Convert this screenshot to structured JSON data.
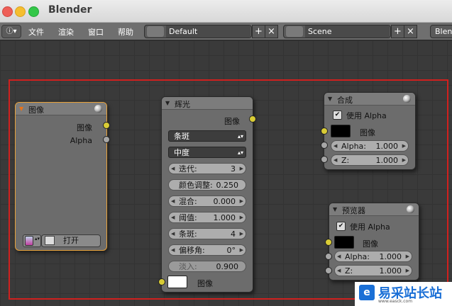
{
  "window": {
    "title": "Blender"
  },
  "menubar": {
    "items": [
      "文件",
      "渲染",
      "窗口",
      "帮助"
    ],
    "layout_value": "Default",
    "scene_value": "Scene",
    "engine_value": "Blen"
  },
  "nodes": {
    "image": {
      "title": "图像",
      "out_image": "图像",
      "out_alpha": "Alpha",
      "open_label": "打开"
    },
    "glare": {
      "title": "辉光",
      "out_image": "图像",
      "glare_type": "条斑",
      "quality": "中度",
      "iterations": {
        "label": "迭代:",
        "value": "3"
      },
      "color_mod": {
        "label": "颜色调整:",
        "value": "0.250"
      },
      "mix": {
        "label": "混合:",
        "value": "0.000"
      },
      "threshold": {
        "label": "阈值:",
        "value": "1.000"
      },
      "streaks": {
        "label": "条斑:",
        "value": "4"
      },
      "angle": {
        "label": "偏移角:",
        "value": "0°"
      },
      "fade": {
        "label": "淡入:",
        "value": "0.900"
      },
      "in_image": "图像"
    },
    "composite": {
      "title": "合成",
      "use_alpha": "使用 Alpha",
      "in_image": "图像",
      "alpha": {
        "label": "Alpha:",
        "value": "1.000"
      },
      "z": {
        "label": "Z:",
        "value": "1.000"
      }
    },
    "viewer": {
      "title": "预览器",
      "use_alpha": "使用 Alpha",
      "in_image": "图像",
      "alpha": {
        "label": "Alpha:",
        "value": "1.000"
      },
      "z": {
        "label": "Z:",
        "value": "1.000"
      }
    }
  },
  "watermark": {
    "text": "易采站长站",
    "sub": "www.easck.com"
  },
  "colors": {
    "selected_border": "#e8a23a",
    "socket_image": "#d9cc35",
    "socket_value": "#a7a7a7",
    "highlight_box": "#d0201e"
  }
}
